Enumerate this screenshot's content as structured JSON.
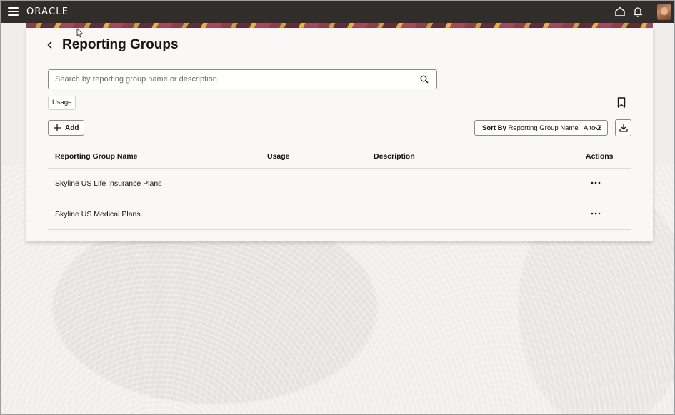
{
  "topbar": {
    "brand": "ORACLE",
    "icons": [
      "menu-icon",
      "home-icon",
      "notifications-icon",
      "user-avatar"
    ]
  },
  "page": {
    "title": "Reporting Groups"
  },
  "search": {
    "placeholder": "Search by reporting group name or description",
    "value": ""
  },
  "filters": {
    "chips": [
      "Usage"
    ]
  },
  "toolbar": {
    "add_label": "Add",
    "sort_prefix": "Sort By",
    "sort_value": "Reporting Group Name , A to Z"
  },
  "table": {
    "columns": [
      "Reporting Group Name",
      "Usage",
      "Description",
      "Actions"
    ],
    "rows": [
      {
        "name": "Skyline US Life Insurance Plans",
        "usage": "",
        "description": ""
      },
      {
        "name": "Skyline US Medical Plans",
        "usage": "",
        "description": ""
      }
    ]
  },
  "colors": {
    "topbar": "#312d2a",
    "card": "#f9f8f6",
    "text": "#161513",
    "border": "#8c8a87"
  }
}
